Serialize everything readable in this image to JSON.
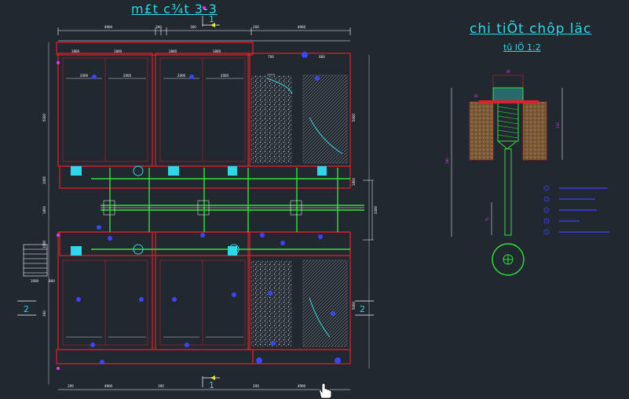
{
  "drawing": {
    "main_title": "m£t c¾t 3-3",
    "detail_title": "chi tiÕt chôp läc",
    "detail_scale": "tû lÖ 1:2"
  },
  "dims": {
    "top_row": [
      "4900",
      "300",
      "300",
      "200",
      "4900"
    ],
    "row2": [
      "1800",
      "1800",
      "1800",
      "1800",
      "700",
      "800"
    ],
    "inner": [
      "2000",
      "2000",
      "2000",
      "2000",
      "2000"
    ],
    "bottom_row": [
      "200",
      "4900",
      "300",
      "200",
      "4900"
    ],
    "left": [
      "300",
      "5000",
      "1000",
      "1000",
      "1800"
    ],
    "right": [
      "5000",
      "1800",
      "5000",
      "3400"
    ],
    "stair": [
      "1000",
      "800"
    ]
  },
  "section_marks": {
    "top": "1",
    "bottom": "1",
    "left": "2",
    "right": "2"
  },
  "detail_dims": {
    "top": "40",
    "side_small": "30",
    "side_right": "110",
    "overall": "280",
    "stem": "70"
  },
  "colors": {
    "background": "#212830",
    "wall": "#e0202a",
    "dimension": "#ffffff",
    "pipe": "#33e03a",
    "cyan": "#2fd8e8",
    "blue": "#3a45ff",
    "magenta": "#e83aff"
  },
  "legend": {
    "items": [
      "1",
      "2",
      "3",
      "4",
      "5"
    ]
  }
}
